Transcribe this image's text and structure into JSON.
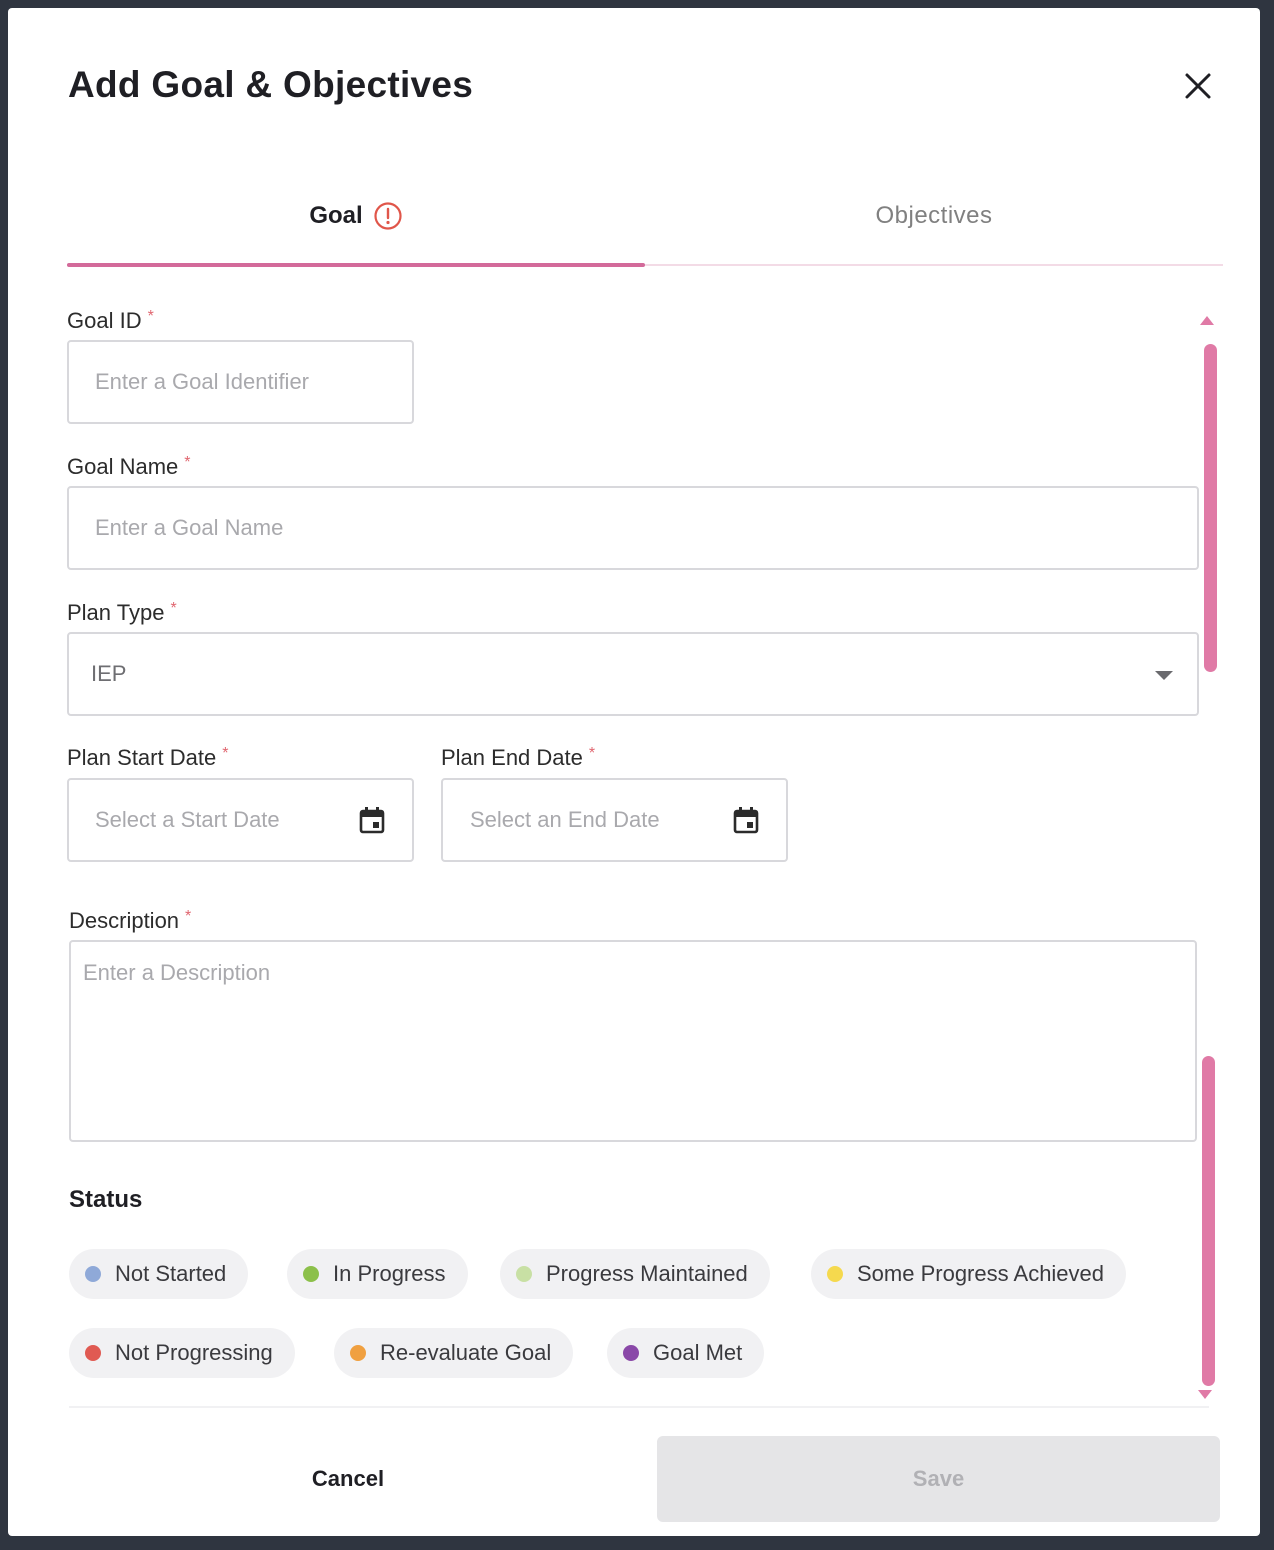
{
  "modal": {
    "title": "Add Goal & Objectives"
  },
  "tabs": {
    "goal_label": "Goal",
    "objectives_label": "Objectives",
    "active": "goal",
    "active_color": "#d36a9a"
  },
  "form": {
    "goal_id": {
      "label": "Goal ID",
      "required_mark": "*",
      "placeholder": "Enter a Goal Identifier",
      "value": ""
    },
    "goal_name": {
      "label": "Goal Name",
      "required_mark": "*",
      "placeholder": "Enter a Goal Name",
      "value": ""
    },
    "plan_type": {
      "label": "Plan Type",
      "required_mark": "*",
      "selected": "IEP"
    },
    "plan_start_date": {
      "label": "Plan Start Date",
      "required_mark": "*",
      "placeholder": "Select a Start Date"
    },
    "plan_end_date": {
      "label": "Plan End Date",
      "required_mark": "*",
      "placeholder": "Select an End Date"
    },
    "description": {
      "label": "Description",
      "required_mark": "*",
      "placeholder": "Enter a Description",
      "value": ""
    }
  },
  "status": {
    "title": "Status",
    "options": [
      {
        "label": "Not Started",
        "color": "#8fa9d8"
      },
      {
        "label": "In Progress",
        "color": "#8cc04a"
      },
      {
        "label": "Progress Maintained",
        "color": "#c8e0a4"
      },
      {
        "label": "Some Progress Achieved",
        "color": "#f5d94e"
      },
      {
        "label": "Not Progressing",
        "color": "#e05a52"
      },
      {
        "label": "Re-evaluate Goal",
        "color": "#f0a040"
      },
      {
        "label": "Goal Met",
        "color": "#8a48a8"
      }
    ]
  },
  "footer": {
    "cancel_label": "Cancel",
    "save_label": "Save"
  }
}
